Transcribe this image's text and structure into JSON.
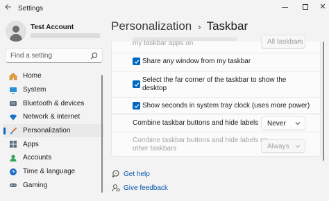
{
  "window": {
    "title": "Settings",
    "back_icon": "back-arrow-icon",
    "minimize_icon": "minimize-icon",
    "maximize_icon": "maximize-icon",
    "close_icon": "close-icon"
  },
  "user": {
    "name": "Test Account",
    "avatar_icon": "user-avatar-icon"
  },
  "search": {
    "placeholder": "Find a setting",
    "icon": "search-icon"
  },
  "sidebar": {
    "items": [
      {
        "label": "Home",
        "icon": "home-icon",
        "active": false
      },
      {
        "label": "System",
        "icon": "system-monitor-icon",
        "active": false
      },
      {
        "label": "Bluetooth & devices",
        "icon": "bluetooth-icon",
        "active": false
      },
      {
        "label": "Network & internet",
        "icon": "wifi-icon",
        "active": false
      },
      {
        "label": "Personalization",
        "icon": "brush-icon",
        "active": true
      },
      {
        "label": "Apps",
        "icon": "apps-grid-icon",
        "active": false
      },
      {
        "label": "Accounts",
        "icon": "person-icon",
        "active": false
      },
      {
        "label": "Time & language",
        "icon": "clock-globe-icon",
        "active": false
      },
      {
        "label": "Gaming",
        "icon": "gamepad-icon",
        "active": false
      }
    ]
  },
  "breadcrumb": {
    "parent": "Personalization",
    "separator": "›",
    "current": "Taskbar"
  },
  "settings": {
    "partial_row": {
      "label": "my taskbar apps on",
      "dropdown": "All taskbars"
    },
    "share_window": {
      "label": "Share any window from my taskbar",
      "checked": true
    },
    "far_corner": {
      "line1": "Select the far corner of the taskbar to show the",
      "line2": "desktop",
      "checked": true
    },
    "show_seconds": {
      "label": "Show seconds in system tray clock (uses more power)",
      "checked": true
    },
    "combine_buttons": {
      "label": "Combine taskbar buttons and hide labels",
      "value": "Never"
    },
    "combine_other": {
      "line1": "Combine taskbar buttons and hide labels on",
      "line2": "other taskbars",
      "value": "Always"
    }
  },
  "links": {
    "help": {
      "label": "Get help",
      "icon": "help-icon"
    },
    "feedback": {
      "label": "Give feedback",
      "icon": "feedback-icon"
    }
  },
  "colors": {
    "accent": "#0067c0",
    "link": "#0055a8",
    "disabled_text": "#a3a3a3"
  }
}
